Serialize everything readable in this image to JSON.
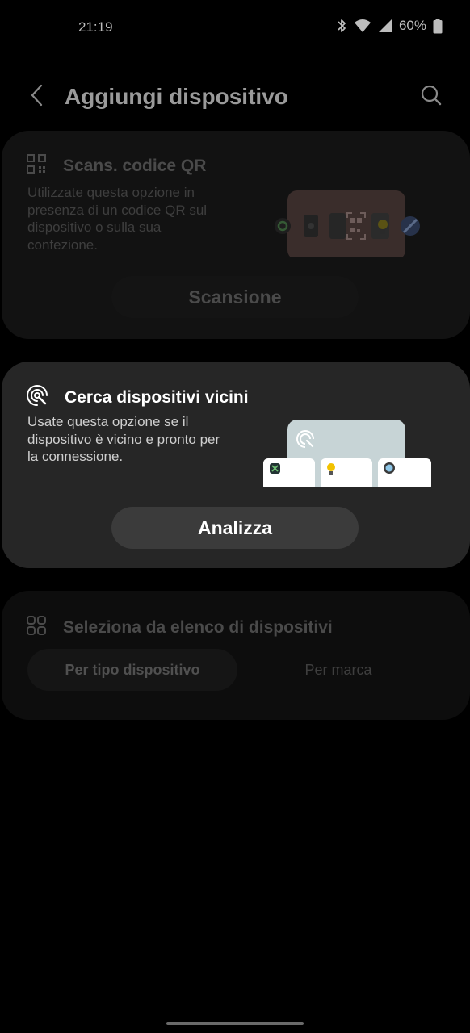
{
  "status_bar": {
    "time": "21:19",
    "battery": "60%",
    "icons": [
      "bluetooth-icon",
      "wifi-icon",
      "signal-icon",
      "battery-icon"
    ]
  },
  "app_bar": {
    "title": "Aggiungi dispositivo",
    "back_icon": "chevron-left-icon",
    "search_icon": "search-icon"
  },
  "qr_card": {
    "icon": "qr-code-icon",
    "title": "Scans. codice QR",
    "description": "Utilizzate questa opzione in presenza di un codice QR sul dispositivo o sulla sua confezione.",
    "button_label": "Scansione"
  },
  "nearby_card": {
    "icon": "nearby-scan-icon",
    "title": "Cerca dispositivi vicini",
    "description": "Usate questa opzione se il dispositivo è vicino e pronto per la connessione.",
    "button_label": "Analizza"
  },
  "list_card": {
    "icon": "grid-icon",
    "title": "Seleziona da elenco di dispositivi",
    "tabs": [
      {
        "label": "Per tipo dispositivo",
        "selected": true
      },
      {
        "label": "Per marca",
        "selected": false
      }
    ]
  },
  "colors": {
    "background": "#000000",
    "active_card": "#262626",
    "active_button": "#3b3b3b",
    "dim_text": "#4a4a4a"
  }
}
